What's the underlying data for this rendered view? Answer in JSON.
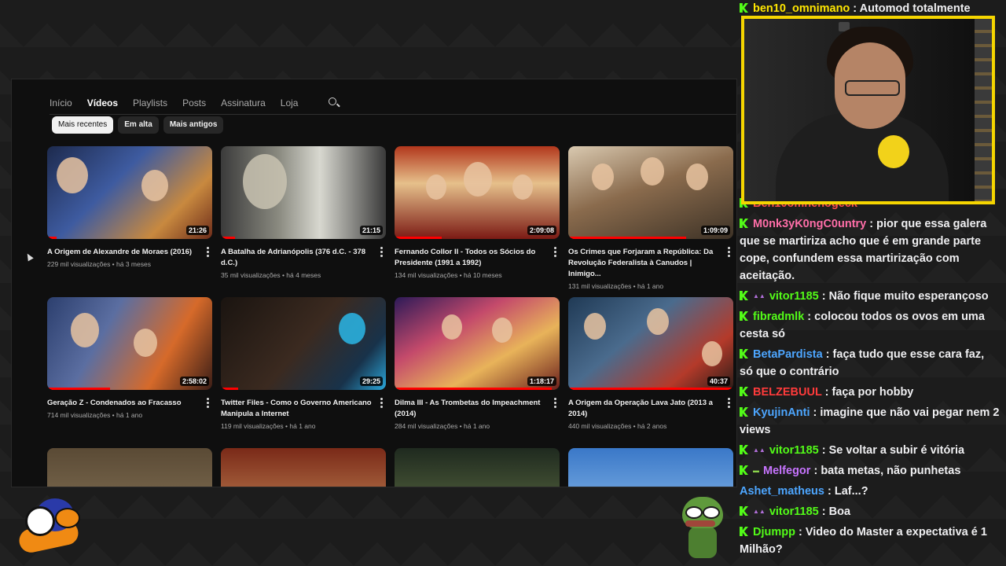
{
  "youtube": {
    "tabs": [
      "Início",
      "Vídeos",
      "Playlists",
      "Posts",
      "Assinatura",
      "Loja"
    ],
    "active_tab": "Vídeos",
    "chips": [
      "Mais recentes",
      "Em alta",
      "Mais antigos"
    ],
    "active_chip": "Mais recentes",
    "videos": [
      {
        "title": "A Origem de Alexandre de Moraes (2016)",
        "meta": "229 mil visualizações • há 3 meses",
        "duration": "21:26"
      },
      {
        "title": "A Batalha de Adrianópolis (376 d.C. - 378 d.C.)",
        "meta": "35 mil visualizações • há 4 meses",
        "duration": "21:15"
      },
      {
        "title": "Fernando Collor II - Todos os Sócios do Presidente (1991 a 1992)",
        "meta": "134 mil visualizações • há 10 meses",
        "duration": "2:09:08"
      },
      {
        "title": "Os Crimes que Forjaram a República: Da Revolução Federalista à Canudos | Inimigo...",
        "meta": "131 mil visualizações • há 1 ano",
        "duration": "1:09:09"
      },
      {
        "title": "Geração Z - Condenados ao Fracasso",
        "meta": "714 mil visualizações • há 1 ano",
        "duration": "2:58:02"
      },
      {
        "title": "Twitter Files - Como o Governo Americano Manipula a Internet",
        "meta": "119 mil visualizações • há 1 ano",
        "duration": "29:25"
      },
      {
        "title": "Dilma III - As Trombetas do Impeachment (2014)",
        "meta": "284 mil visualizações • há 1 ano",
        "duration": "1:18:17"
      },
      {
        "title": "A Origem da Operação Lava Jato (2013 a 2014)",
        "meta": "440 mil visualizações • há 2 anos",
        "duration": "40:37"
      }
    ]
  },
  "chat": [
    {
      "user": "ben10_omnimano",
      "color": "#ffe600",
      "text": "Automod totalmente"
    },
    {
      "user": "Ben10omnenogeck",
      "color": "#ff4d4d",
      "text": ""
    },
    {
      "user": "M0nk3yK0ngC0untry",
      "color": "#ff6ea8",
      "text": "pior que essa galera que se martiriza acho que é em grande parte cope, confundem essa martirização com aceitação."
    },
    {
      "user": "vitor1185",
      "color": "#53fc18",
      "text": "Não fique muito esperançoso",
      "sub": true
    },
    {
      "user": "fibradmlk",
      "color": "#53fc18",
      "text": "colocou todos os ovos em uma cesta só"
    },
    {
      "user": "BetaPardista",
      "color": "#4da6ff",
      "text": "faça tudo que esse cara faz, só que o contrário"
    },
    {
      "user": "BELZEBUUL",
      "color": "#ff3b3b",
      "text": "faça por hobby"
    },
    {
      "user": "KyujinAnti",
      "color": "#4da6ff",
      "text": "imagine que não vai pegar nem 2 views"
    },
    {
      "user": "vitor1185",
      "color": "#53fc18",
      "text": "Se voltar a subir é vitória",
      "sub": true
    },
    {
      "user": "Melfegor",
      "color": "#c774ff",
      "text": "bata metas, não punhetas",
      "sub": true
    },
    {
      "user": "Ashet_matheus",
      "color": "#4da6ff",
      "text": "Laf...?"
    },
    {
      "user": "vitor1185",
      "color": "#53fc18",
      "text": "Boa",
      "sub": true
    },
    {
      "user": "Djumpp",
      "color": "#53fc18",
      "text": "Video do Master a expectativa é 1 Milhão?"
    }
  ],
  "colors": {
    "webcam_border": "#f5d500",
    "yt_progress": "#ff0000",
    "kick_badge": "#53fc18"
  }
}
